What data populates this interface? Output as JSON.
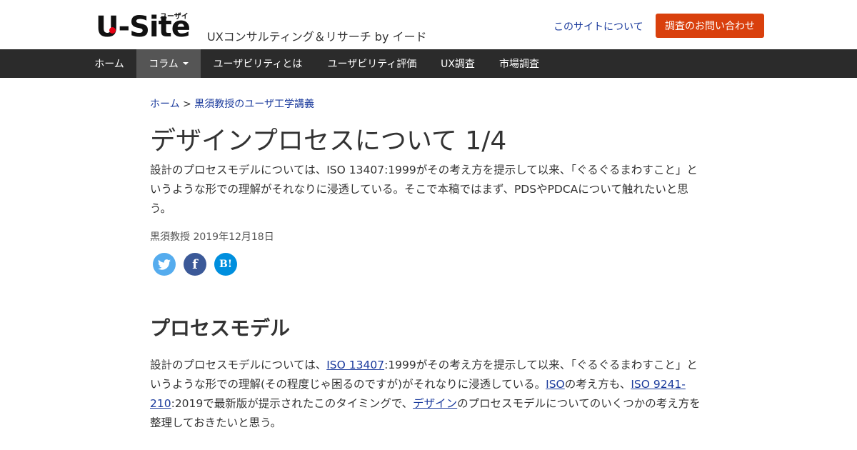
{
  "header": {
    "logo_text": "U-Site",
    "logo_ruby": "ユーザイト",
    "tagline": "UXコンサルティング＆リサーチ by イード",
    "about_link": "このサイトについて",
    "contact_button": "調査のお問い合わせ",
    "contact_color": "#d9400d"
  },
  "nav": {
    "items": [
      {
        "label": "ホーム"
      },
      {
        "label": "コラム",
        "active": true,
        "dropdown": true
      },
      {
        "label": "ユーザビリティとは"
      },
      {
        "label": "ユーザビリティ評価"
      },
      {
        "label": "UX調査"
      },
      {
        "label": "市場調査"
      }
    ]
  },
  "breadcrumb": {
    "home": "ホーム",
    "separator": ">",
    "current": "黒須教授のユーザ工学講義"
  },
  "article": {
    "title": "デザインプロセスについて 1/4",
    "lead": "設計のプロセスモデルについては、ISO 13407:1999がその考え方を提示して以来、「ぐるぐるまわすこと」というような形での理解がそれなりに浸透している。そこで本稿ではまず、PDSやPDCAについて触れたいと思う。",
    "byline": "黒須教授 2019年12月18日",
    "share": {
      "twitter_icon": "twitter-icon",
      "facebook_label": "f",
      "hatena_label": "B!"
    },
    "section_heading": "プロセスモデル",
    "body": {
      "t1": "設計のプロセスモデルについては、",
      "link1": "ISO 13407",
      "t2": ":1999がその考え方を提示して以来、「ぐるぐるまわすこと」というような形での理解(その程度じゃ困るのですが)がそれなりに浸透している。",
      "link2": "ISO",
      "t3": "の考え方も、",
      "link3": "ISO 9241-210",
      "t4": ":2019で最新版が提示されたこのタイミングで、",
      "link4": "デザイン",
      "t5": "のプロセスモデルについてのいくつかの考え方を整理しておきたいと思う。"
    }
  }
}
